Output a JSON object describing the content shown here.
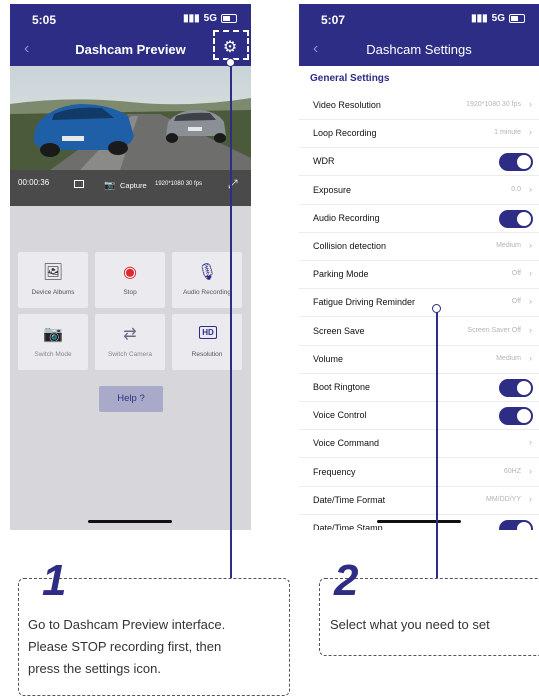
{
  "screen1": {
    "status_time": "5:05",
    "status_signal": "5G",
    "title": "Dashcam Preview",
    "back_icon": "chevron-left-icon",
    "settings_icon": "gear-icon",
    "controls": {
      "timer": "00:00:36",
      "capture_label": "Capture",
      "resolution": "1920*1080 30 fps"
    },
    "tiles": [
      {
        "label": "Device Albums",
        "icon": "album-icon"
      },
      {
        "label": "Stop",
        "icon": "stop-icon"
      },
      {
        "label": "Audio Recording",
        "icon": "microphone-icon"
      },
      {
        "label": "Switch Mode",
        "icon": "camera-icon"
      },
      {
        "label": "Switch Camera",
        "icon": "switch-camera-icon"
      },
      {
        "label": "Resolution",
        "icon": "hd-icon",
        "icon_text": "HD"
      }
    ],
    "help_label": "Help ?"
  },
  "screen2": {
    "status_time": "5:07",
    "status_signal": "5G",
    "title": "Dashcam Settings",
    "back_icon": "chevron-left-icon",
    "section": "General Settings",
    "rows": [
      {
        "label": "Video Resolution",
        "value": "1920*1080 30 fps",
        "type": "value"
      },
      {
        "label": "Loop Recording",
        "value": "1 minute",
        "type": "value"
      },
      {
        "label": "WDR",
        "value": "",
        "type": "toggle"
      },
      {
        "label": "Exposure",
        "value": "0.0",
        "type": "value"
      },
      {
        "label": "Audio Recording",
        "value": "",
        "type": "toggle"
      },
      {
        "label": "Collision detection",
        "value": "Medium",
        "type": "value"
      },
      {
        "label": "Parking Mode",
        "value": "Off",
        "type": "value"
      },
      {
        "label": "Fatigue Driving Reminder",
        "value": "Off",
        "type": "value"
      },
      {
        "label": "Screen Save",
        "value": "Screen Saver Off",
        "type": "value"
      },
      {
        "label": "Volume",
        "value": "Medium",
        "type": "value"
      },
      {
        "label": "Boot Ringtone",
        "value": "",
        "type": "toggle"
      },
      {
        "label": "Voice Control",
        "value": "",
        "type": "toggle"
      },
      {
        "label": "Voice Command",
        "value": "",
        "type": "value"
      },
      {
        "label": "Frequency",
        "value": "60HZ",
        "type": "value"
      },
      {
        "label": "Date/Time Format",
        "value": "MM/DD/YY",
        "type": "value"
      },
      {
        "label": "Date/Time Stamp",
        "value": "",
        "type": "toggle"
      }
    ]
  },
  "steps": [
    {
      "number": "1",
      "lines": [
        "Go to Dashcam Preview interface.",
        "Please STOP recording first, then",
        "press the settings icon."
      ]
    },
    {
      "number": "2",
      "lines": [
        "Select what you need to set"
      ]
    }
  ],
  "colors": {
    "brand": "#2e2d86",
    "stop": "#e0282a",
    "toggle_on": "#2e2d86"
  }
}
